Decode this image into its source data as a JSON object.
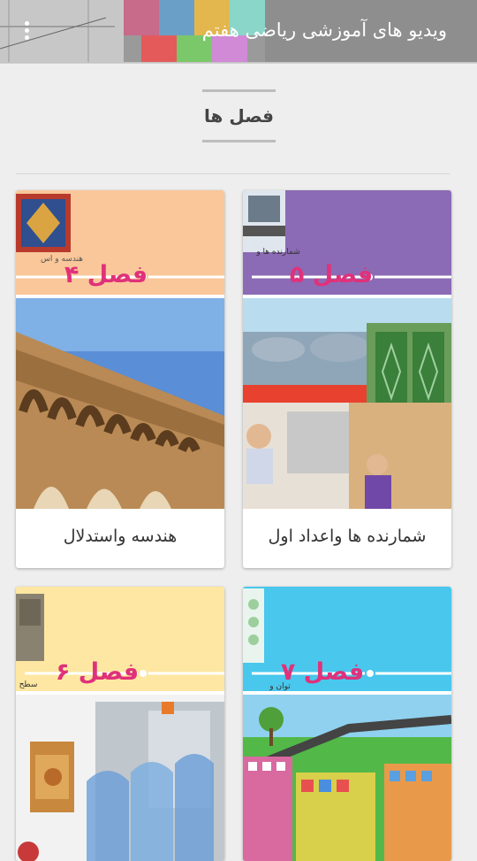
{
  "app_bar": {
    "title": "ویدیو های آموزشی ریاضی هفتم",
    "menu_icon": "more-vert-icon"
  },
  "section": {
    "heading": "فصل ها"
  },
  "chapters": [
    {
      "cover_heading": "فصل ۵",
      "cover_subtitle": "شمارنده ها و",
      "label": "شمارنده ها واعداد اول",
      "color": "#8b6bb5"
    },
    {
      "cover_heading": "فصل ۴",
      "cover_subtitle": "هندسه و اس",
      "label": "هندسه واستدلال",
      "color": "#f9c79a"
    },
    {
      "cover_heading": "فصل ۷",
      "cover_subtitle": "توان و",
      "label": "",
      "color": "#49c7ec"
    },
    {
      "cover_heading": "فصل ۶",
      "cover_subtitle": "سطح",
      "label": "",
      "color": "#fde7a2"
    }
  ],
  "colors": {
    "chapter_title_text": "#e0317a",
    "background": "#eeeeee"
  }
}
